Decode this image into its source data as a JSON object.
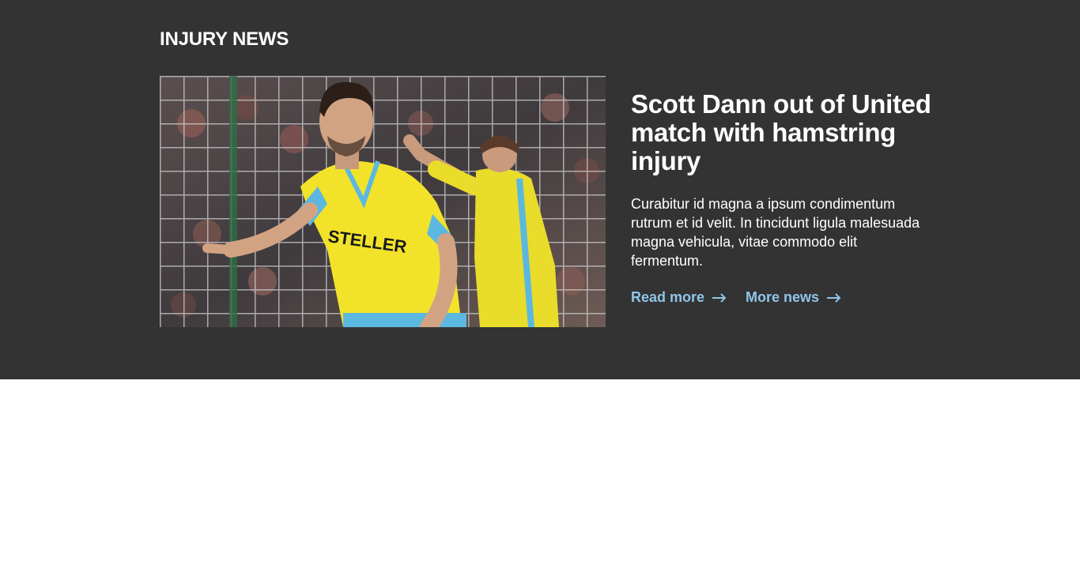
{
  "section": {
    "title": "INJURY NEWS"
  },
  "article": {
    "headline": "Scott Dann out of United match with hamstring injury",
    "summary": "Curabitur id magna a ipsum condimentum rutrum et id velit. In tincidunt ligula malesuada magna vehicula, vitae commodo elit fermentum.",
    "photo": {
      "shirt_text": "STELLER"
    }
  },
  "links": {
    "read_more": "Read more",
    "more_news": "More news"
  },
  "colors": {
    "band_background": "#333333",
    "page_background": "#ffffff",
    "link": "#8ec6ea",
    "kit_yellow": "#f2e32a",
    "kit_blue": "#5cb8e0"
  },
  "icons": {
    "link_arrow": "arrow-right-icon"
  }
}
